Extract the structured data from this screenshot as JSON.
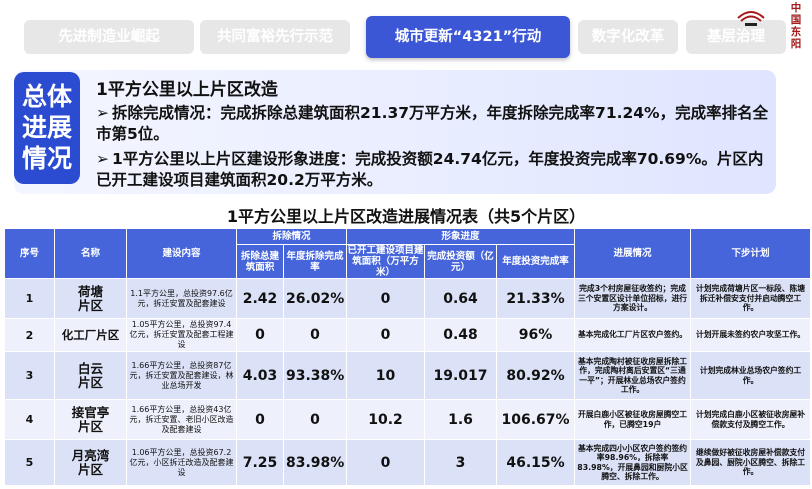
{
  "nav": {
    "tabs": [
      {
        "label": "先进制造业崛起",
        "active": false
      },
      {
        "label": "共同富裕先行示范",
        "active": false
      },
      {
        "label": "城市更新“4321”行动",
        "active": true
      },
      {
        "label": "数字化改革",
        "active": false
      },
      {
        "label": "基层治理",
        "active": false
      }
    ],
    "logo_text": "中国东阳"
  },
  "summary": {
    "badge_lines": [
      "总体",
      "进展",
      "情况"
    ],
    "title": "1平方公里以上片区改造",
    "items": [
      "拆除完成情况：完成拆除总建筑面积21.37万平方米，年度拆除完成率71.24%，完成率排名全市第5位。",
      "1平方公里以上片区建设形象进度：完成投资额24.74亿元，年度投资完成率70.69%。片区内已开工建设项目建筑面积20.2万平方米。"
    ],
    "arrow": "➢"
  },
  "table": {
    "title": "1平方公里以上片区改造进展情况表（共5个片区）",
    "headers": {
      "seq": "序号",
      "name": "名称",
      "content": "建设内容",
      "demolition_group": "拆除情况",
      "demolition_area": "拆除总建筑面积",
      "demolition_rate": "年度拆除完成率",
      "image_group": "形象进度",
      "started_area": "已开工建设项目建筑面积（万平方米）",
      "investment": "完成投资额（亿元）",
      "investment_rate": "年度投资完成率",
      "progress": "进展情况",
      "next_plan": "下步计划"
    },
    "rows": [
      {
        "seq": "1",
        "name": "荷塘\n片区",
        "content": "1.1平方公里，总投资97.6亿元，拆迁安置及配套建设",
        "demolition_area": "2.42",
        "demolition_rate": "26.02%",
        "started_area": "0",
        "investment": "0.64",
        "investment_rate": "21.33%",
        "progress": "完成3个村房屋征收签约；完成三个安置区设计单位招标，进行方案设计。",
        "next_plan": "计划完成荷塘片区一标段、陈塘拆迁补偿安支付并启动腾空工作。"
      },
      {
        "seq": "2",
        "name": "化工厂片区",
        "content": "1.05平方公里，总投资97.4亿元，拆迁安置及配套工程建设",
        "demolition_area": "0",
        "demolition_rate": "0",
        "started_area": "0",
        "investment": "0.48",
        "investment_rate": "96%",
        "progress": "基本完成化工厂片区农户签约。",
        "next_plan": "计划开展未签约农户攻坚工作。"
      },
      {
        "seq": "3",
        "name": "白云\n片区",
        "content": "1.66平方公里，总投资87亿元，拆迁安置及配套建设，林业总场开发",
        "demolition_area": "4.03",
        "demolition_rate": "93.38%",
        "started_area": "10",
        "investment": "19.017",
        "investment_rate": "80.92%",
        "progress": "基本完成陶村被征收房屋拆除工作，完成陶村离后安置区“三通一平”；开展林业总场农户签约工作。",
        "next_plan": "计划完成林业总场农户签约工作。"
      },
      {
        "seq": "4",
        "name": "接官亭\n片区",
        "content": "1.66平方公里，总投资43亿元，拆迁安置、老旧小区改造及配套建设",
        "demolition_area": "0",
        "demolition_rate": "0",
        "started_area": "10.2",
        "investment": "1.6",
        "investment_rate": "106.67%",
        "progress": "开展白鹿小区被征收房屋腾空工作，已腾空19户",
        "next_plan": "计划完成白鹿小区被征收房屋补偿款支付及腾空工作。"
      },
      {
        "seq": "5",
        "name": "月亮湾\n片区",
        "content": "1.06平方公里，总投资67.2亿元，小区拆迁改造及配套建设",
        "demolition_area": "7.25",
        "demolition_rate": "83.98%",
        "started_area": "0",
        "investment": "3",
        "investment_rate": "46.15%",
        "progress": "基本完成四小小区农户签约签约率98.96%，拆除率83.98%，开展鼻园和厨院小区腾空、拆除工作。",
        "next_plan": "继续做好被征收房屋补偿款支付及鼻园、厨院小区腾空、拆除工作。"
      }
    ]
  },
  "colors": {
    "accent": "#3b57d6",
    "header_bg": "#4665db",
    "badge_bg": "#2b4bd1",
    "row_odd": "#dbe2f7",
    "row_even": "#eef1fb",
    "tab_inactive": "#e7e7e7"
  }
}
